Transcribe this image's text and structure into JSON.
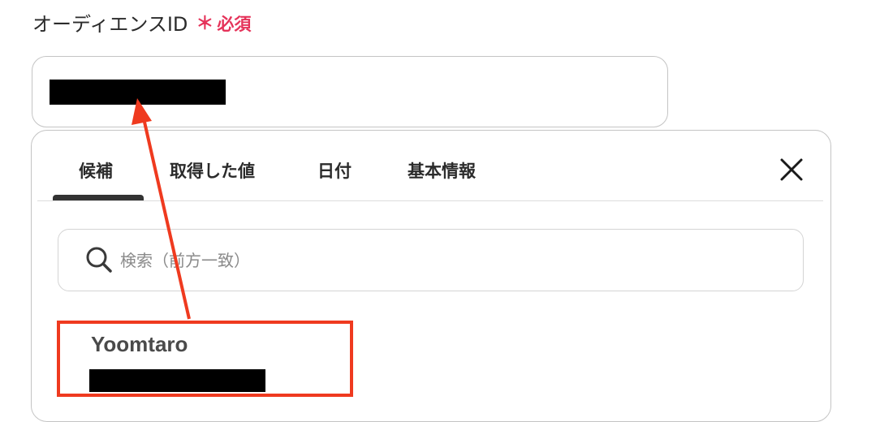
{
  "field": {
    "label": "オーディエンスID",
    "required_mark": "＊",
    "required_text": "必須"
  },
  "tabs": [
    {
      "label": "候補"
    },
    {
      "label": "取得した値"
    },
    {
      "label": "日付"
    },
    {
      "label": "基本情報"
    }
  ],
  "active_tab": "候補",
  "search": {
    "placeholder": "検索（前方一致）"
  },
  "candidates": [
    {
      "name": "Yoomtaro"
    }
  ],
  "icons": [
    "search-icon",
    "close-icon"
  ],
  "colors": {
    "required": "#e5335a",
    "annotation": "#ef3a1f",
    "tab_underline": "#333333"
  }
}
